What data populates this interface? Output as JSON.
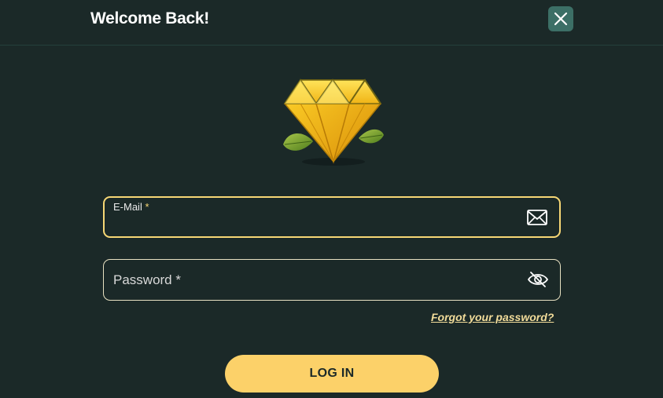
{
  "modal": {
    "title": "Welcome Back!",
    "close_icon": "close-icon"
  },
  "logo": {
    "icon": "diamond-with-leaves-logo",
    "colors": {
      "gem": "#f3c21c",
      "leaf": "#8fb12f"
    }
  },
  "email": {
    "label": "E-Mail",
    "required_mark": "*",
    "value": "",
    "icon": "envelope-icon"
  },
  "password": {
    "label": "Password *",
    "value": "",
    "icon": "eye-off-icon"
  },
  "forgot_link": "Forgot your password?",
  "login_button": "LOG IN",
  "colors": {
    "background": "#1b2928",
    "accent": "#fcd169",
    "focus_border": "#f7d775",
    "close_button": "#3c6f66"
  }
}
